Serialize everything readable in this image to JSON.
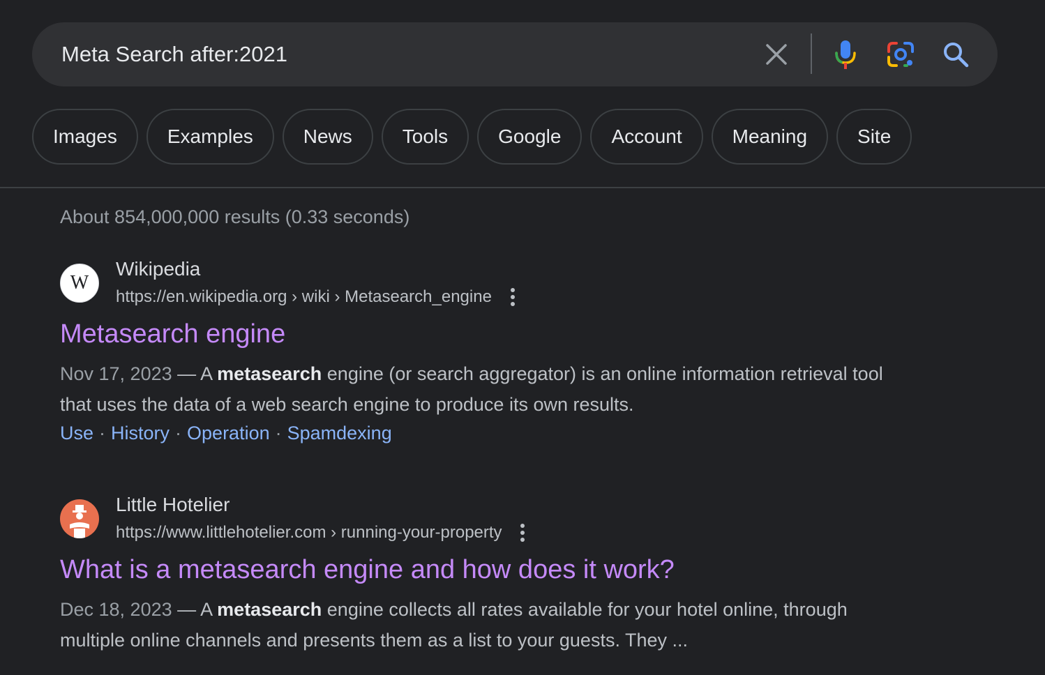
{
  "search": {
    "query": "Meta Search after:2021"
  },
  "chips": [
    "Images",
    "Examples",
    "News",
    "Tools",
    "Google",
    "Account",
    "Meaning",
    "Site"
  ],
  "stats": "About 854,000,000 results (0.33 seconds)",
  "results": [
    {
      "favicon_letter": "W",
      "site_name": "Wikipedia",
      "url": "https://en.wikipedia.org › wiki › Metasearch_engine",
      "title": "Metasearch engine",
      "date": "Nov 17, 2023",
      "dash": " — ",
      "snippet_pre": "A ",
      "snippet_bold": "metasearch",
      "snippet_post": " engine (or search aggregator) is an online information retrieval tool that uses the data of a web search engine to produce its own results.",
      "sitelinks": [
        "Use",
        "History",
        "Operation",
        "Spamdexing"
      ]
    },
    {
      "site_name": "Little Hotelier",
      "url": "https://www.littlehotelier.com › running-your-property",
      "title": "What is a metasearch engine and how does it work?",
      "date": "Dec 18, 2023",
      "dash": " — ",
      "snippet_pre": "A ",
      "snippet_bold": "metasearch",
      "snippet_post": " engine collects all rates available for your hotel online, through multiple online channels and presents them as a list to your guests. They ..."
    }
  ],
  "sitelink_separator": "·",
  "colors": {
    "background": "#202124",
    "visited_link": "#c58af9",
    "link": "#8ab4f8",
    "google_blue": "#4285f4",
    "google_red": "#ea4335",
    "google_yellow": "#fbbc04",
    "google_green": "#34a853",
    "hotelier_orange": "#e8704f"
  },
  "icons": [
    "clear-icon",
    "mic-icon",
    "lens-icon",
    "search-icon",
    "more-vert-icon"
  ]
}
